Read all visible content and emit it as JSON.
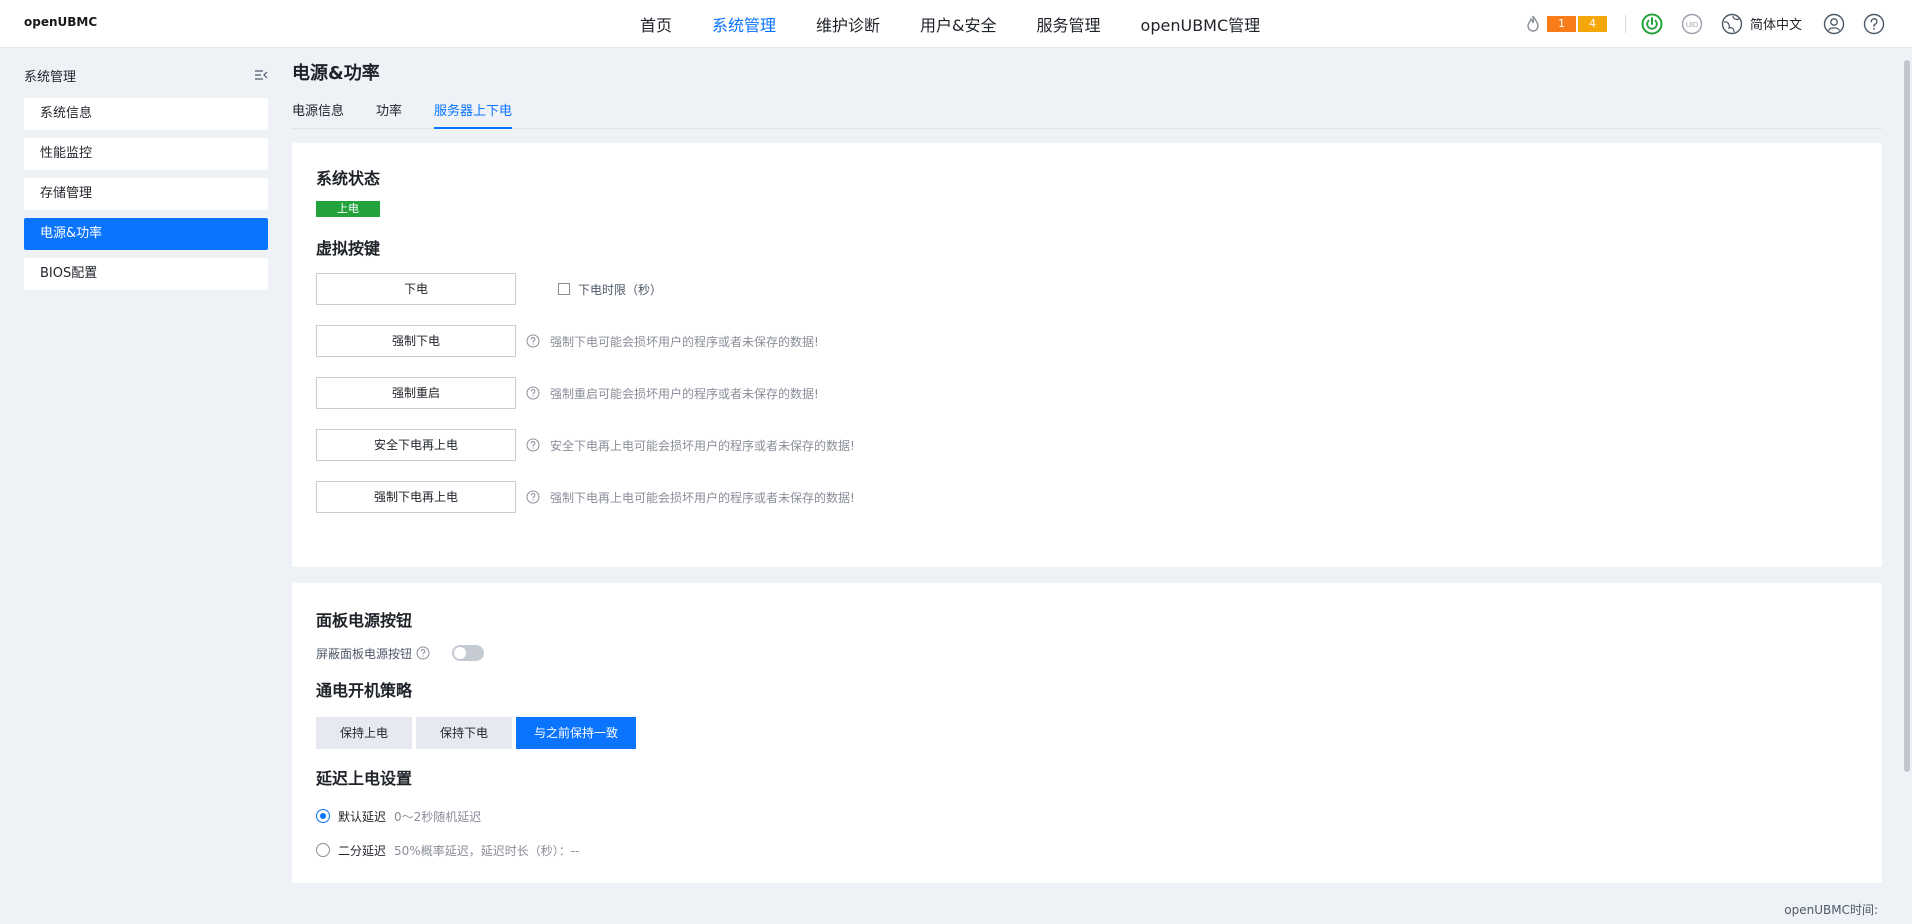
{
  "app": {
    "logo": "openUBMC"
  },
  "topnav": {
    "items": [
      {
        "label": "首页"
      },
      {
        "label": "系统管理"
      },
      {
        "label": "维护诊断"
      },
      {
        "label": "用户&安全"
      },
      {
        "label": "服务管理"
      },
      {
        "label": "openUBMC管理"
      }
    ],
    "active_index": 1
  },
  "topright": {
    "alarm_major": "1",
    "alarm_minor": "4",
    "language": "简体中文",
    "icons": [
      "flame-icon",
      "power-icon",
      "uid-icon",
      "globe-icon",
      "user-icon",
      "help-icon"
    ]
  },
  "sidebar": {
    "title": "系统管理",
    "items": [
      {
        "label": "系统信息"
      },
      {
        "label": "性能监控"
      },
      {
        "label": "存储管理"
      },
      {
        "label": "电源&功率"
      },
      {
        "label": "BIOS配置"
      }
    ],
    "active_index": 3
  },
  "page": {
    "title": "电源&功率",
    "tabs": [
      {
        "label": "电源信息"
      },
      {
        "label": "功率"
      },
      {
        "label": "服务器上下电"
      }
    ],
    "active_tab": 2
  },
  "system_status": {
    "title": "系统状态",
    "status": "上电",
    "status_color": "#22a33c"
  },
  "virtual_keys": {
    "title": "虚拟按键",
    "power_off": "下电",
    "power_off_timeout_label": "下电时限（秒）",
    "force_off": "强制下电",
    "force_off_warn": "强制下电可能会损坏用户的程序或者未保存的数据!",
    "force_reset": "强制重启",
    "force_reset_warn": "强制重启可能会损坏用户的程序或者未保存的数据!",
    "safe_cycle": "安全下电再上电",
    "safe_cycle_warn": "安全下电再上电可能会损坏用户的程序或者未保存的数据!",
    "force_cycle": "强制下电再上电",
    "force_cycle_warn": "强制下电再上电可能会损坏用户的程序或者未保存的数据!"
  },
  "panel_power_button": {
    "title": "面板电源按钮",
    "mask_label": "屏蔽面板电源按钮",
    "mask_enabled": false
  },
  "power_on_policy": {
    "title": "通电开机策略",
    "options": [
      "保持上电",
      "保持下电",
      "与之前保持一致"
    ],
    "selected_index": 2
  },
  "delay_power_on": {
    "title": "延迟上电设置",
    "default_label": "默认延迟",
    "default_desc": "0～2秒随机延迟",
    "half_label": "二分延迟",
    "half_desc": "50%概率延迟，延迟时长（秒）：--"
  },
  "footer": {
    "time_label": "openUBMC时间:"
  },
  "colors": {
    "accent": "#0a74ff",
    "status_on": "#22a33c",
    "alarm_orange": "#f97c1a",
    "alarm_yellow": "#f5a70a"
  }
}
